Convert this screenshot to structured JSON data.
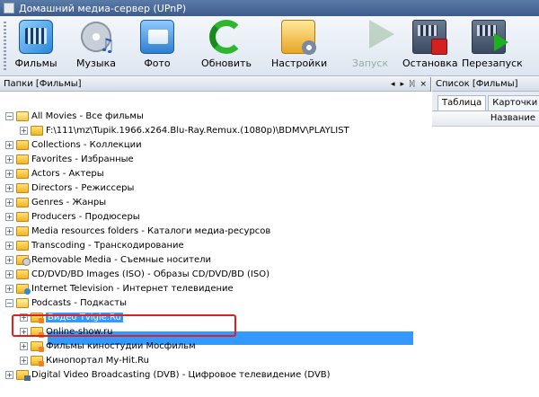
{
  "window": {
    "title": "Домашний медиа-сервер (UPnP)"
  },
  "toolbar": {
    "buttons": [
      {
        "label": "Фильмы",
        "icon": "film-library-icon"
      },
      {
        "label": "Музыка",
        "icon": "music-cd-icon"
      },
      {
        "label": "Фото",
        "icon": "photo-album-icon"
      },
      {
        "label": "Обновить",
        "icon": "refresh-icon"
      },
      {
        "label": "Настройки",
        "icon": "settings-icon"
      },
      {
        "label": "Запуск",
        "icon": "start-icon",
        "disabled": true
      },
      {
        "label": "Остановка",
        "icon": "stop-server-icon"
      },
      {
        "label": "Перезапуск",
        "icon": "restart-server-icon"
      }
    ]
  },
  "left_panel": {
    "title": "Папки [Фильмы]",
    "controls": [
      "◂",
      "▸",
      "ᛞ",
      "×"
    ],
    "tree": [
      {
        "label": "All Movies - Все фильмы",
        "expander": "−",
        "icon": "folder-open",
        "indent": 0
      },
      {
        "label": "F:\\111\\mz\\Tupik.1966.x264.Blu-Ray.Remux.(1080p)\\BDMV\\PLAYLIST",
        "expander": "+",
        "icon": "folder",
        "indent": 1
      },
      {
        "label": "Collections - Коллекции",
        "expander": "+",
        "icon": "folder",
        "indent": 0
      },
      {
        "label": "Favorites - Избранные",
        "expander": "+",
        "icon": "folder",
        "indent": 0
      },
      {
        "label": "Actors - Актеры",
        "expander": "+",
        "icon": "folder",
        "indent": 0
      },
      {
        "label": "Directors - Режиссеры",
        "expander": "+",
        "icon": "folder",
        "indent": 0
      },
      {
        "label": "Genres - Жанры",
        "expander": "+",
        "icon": "folder",
        "indent": 0
      },
      {
        "label": "Producers - Продюсеры",
        "expander": "+",
        "icon": "folder",
        "indent": 0
      },
      {
        "label": "Media resources folders - Каталоги медиа-ресурсов",
        "expander": "+",
        "icon": "folder",
        "indent": 0
      },
      {
        "label": "Transcoding - Транскодирование",
        "expander": "+",
        "icon": "folder",
        "indent": 0
      },
      {
        "label": "Removable Media - Съемные носители",
        "expander": "+",
        "icon": "disc",
        "indent": 0
      },
      {
        "label": "CD/DVD/BD Images (ISO) - Образы CD/DVD/BD (ISO)",
        "expander": "+",
        "icon": "folder",
        "indent": 0
      },
      {
        "label": "Internet Television - Интернет телевидение",
        "expander": "+",
        "icon": "globe",
        "indent": 0
      },
      {
        "label": "Podcasts - Подкасты",
        "expander": "−",
        "icon": "folder-open",
        "indent": 0
      },
      {
        "label": "Видео Tvigle.Ru",
        "expander": "+",
        "icon": "rss",
        "indent": 1,
        "selected": true
      },
      {
        "label": "Online-show.ru",
        "expander": "+",
        "icon": "rss",
        "indent": 1
      },
      {
        "label": "Фильмы киностудии Мосфильм",
        "expander": "+",
        "icon": "rss",
        "indent": 1
      },
      {
        "label": "Кинопортал My-Hit.Ru",
        "expander": "+",
        "icon": "rss",
        "indent": 1
      },
      {
        "label": "Digital Video Broadcasting (DVB) - Цифровое телевидение (DVB)",
        "expander": "+",
        "icon": "dvb",
        "indent": 0
      }
    ]
  },
  "right_panel": {
    "title": "Список [Фильмы]",
    "tabs": [
      "Таблица",
      "Карточки"
    ],
    "column_header": "Название"
  },
  "colors": {
    "selection": "#3399ff",
    "highlight_outline": "#e02020",
    "title_bar": "#3d5c8c"
  }
}
